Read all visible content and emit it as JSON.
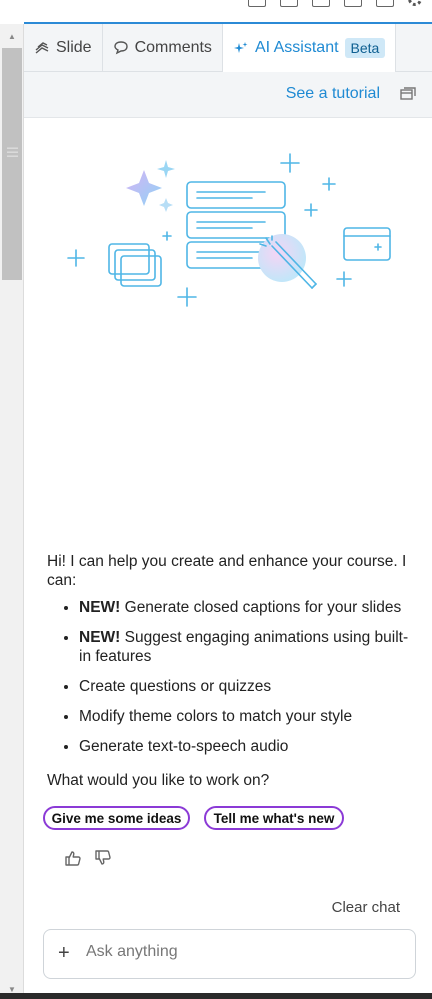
{
  "tabs": [
    {
      "label": "Slide",
      "icon": "slide-icon"
    },
    {
      "label": "Comments",
      "icon": "comment-icon"
    },
    {
      "label": "AI Assistant",
      "icon": "sparkle-icon",
      "badge": "Beta",
      "active": true
    }
  ],
  "tutorial": {
    "label": "See a tutorial",
    "icon": "window-icon"
  },
  "message": {
    "intro": "Hi! I can help you create and enhance your course. I can:",
    "items": [
      {
        "strong": "NEW!",
        "text": " Generate closed captions for your slides"
      },
      {
        "strong": "NEW!",
        "text": " Suggest engaging animations using built-in features"
      },
      {
        "strong": "",
        "text": "Create questions or quizzes"
      },
      {
        "strong": "",
        "text": "Modify theme colors to match your style"
      },
      {
        "strong": "",
        "text": "Generate text-to-speech audio"
      }
    ],
    "question": "What would you like to work on?"
  },
  "suggestions": [
    "Give me some ideas",
    "Tell me what's new"
  ],
  "clear_chat": "Clear chat",
  "ask": {
    "placeholder": "Ask anything"
  },
  "colors": {
    "accent": "#1f8ad3",
    "chip_border": "#8b3ad6",
    "illustration": "#4fb6e6"
  }
}
